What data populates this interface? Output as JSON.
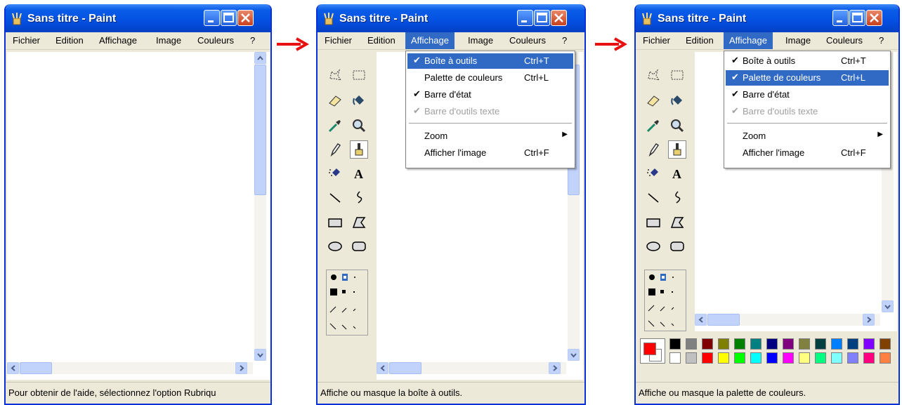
{
  "window_title": "Sans titre - Paint",
  "menus": [
    "Fichier",
    "Edition",
    "Affichage",
    "Image",
    "Couleurs",
    "?"
  ],
  "status_texts": [
    "Pour obtenir de l'aide, sélectionnez l'option Rubriqu",
    "Affiche ou masque la boîte à outils.",
    "Affiche ou masque la palette de couleurs."
  ],
  "affichage_menu": {
    "items": [
      {
        "label": "Boîte à outils",
        "shortcut": "Ctrl+T"
      },
      {
        "label": "Palette de couleurs",
        "shortcut": "Ctrl+L"
      },
      {
        "label": "Barre d'état",
        "shortcut": ""
      },
      {
        "label": "Barre d'outils texte",
        "shortcut": ""
      },
      {
        "label": "Zoom",
        "shortcut": ""
      },
      {
        "label": "Afficher l'image",
        "shortcut": "Ctrl+F"
      }
    ],
    "check_mark": "✔",
    "submenu_arrow": "▶"
  },
  "panel2_menu_state": {
    "checked": [
      true,
      false,
      true,
      true
    ],
    "highlighted": 0
  },
  "panel3_menu_state": {
    "checked": [
      true,
      true,
      true,
      true
    ],
    "highlighted": 1
  },
  "palette": {
    "foreground": "#ff0000",
    "background": "#ffffff",
    "row1": [
      "#000000",
      "#808080",
      "#800000",
      "#808000",
      "#008000",
      "#008080",
      "#000080",
      "#800080",
      "#808040",
      "#004040",
      "#0080ff",
      "#004080",
      "#8000ff",
      "#804000"
    ],
    "row2": [
      "#ffffff",
      "#c0c0c0",
      "#ff0000",
      "#ffff00",
      "#00ff00",
      "#00ffff",
      "#0000ff",
      "#ff00ff",
      "#ffff80",
      "#00ff80",
      "#80ffff",
      "#8080ff",
      "#ff0080",
      "#ff8040"
    ]
  },
  "colors": {
    "accent": "#316ac5",
    "titlebar": "#0450e1",
    "arrow": "#e81010"
  },
  "icons": [
    "paint-app-icon",
    "minimize-icon",
    "maximize-icon",
    "close-icon",
    "free-select-icon",
    "rect-select-icon",
    "eraser-icon",
    "fill-icon",
    "color-picker-icon",
    "magnifier-icon",
    "pencil-icon",
    "brush-icon",
    "airbrush-icon",
    "text-icon",
    "line-icon",
    "curve-icon",
    "rectangle-icon",
    "polygon-icon",
    "ellipse-icon",
    "rounded-rect-icon",
    "arrow-right-icon"
  ]
}
